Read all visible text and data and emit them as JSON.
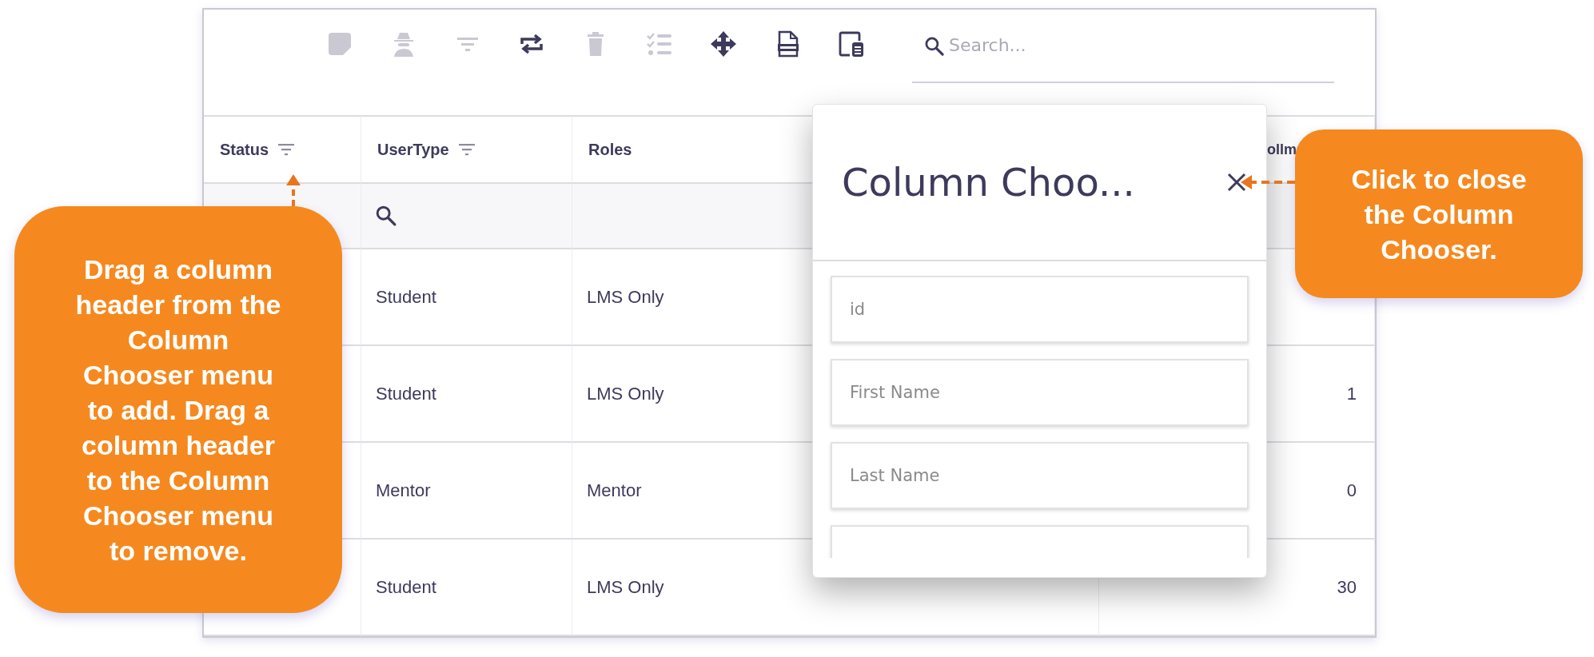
{
  "toolbar": {
    "buttons": [
      {
        "kind": "note",
        "disabled": true
      },
      {
        "kind": "spy",
        "disabled": true
      },
      {
        "kind": "filter",
        "disabled": true
      },
      {
        "kind": "repeat",
        "disabled": false
      },
      {
        "kind": "delete",
        "disabled": true
      },
      {
        "kind": "checklist",
        "disabled": true
      },
      {
        "kind": "move",
        "disabled": false
      },
      {
        "kind": "sheet",
        "disabled": false
      },
      {
        "kind": "panel",
        "disabled": false
      }
    ]
  },
  "search": {
    "placeholder": "Search..."
  },
  "table": {
    "columns": [
      {
        "label": "Status",
        "filter": true
      },
      {
        "label": "UserType",
        "filter": true
      },
      {
        "label": "Roles",
        "filter": false
      },
      {
        "label": "ollm",
        "filter": false
      }
    ],
    "filter_row": [
      {
        "kind": "blank"
      },
      {
        "kind": "search"
      },
      {
        "kind": "blank"
      },
      {
        "kind": "blank"
      }
    ],
    "rows": [
      {
        "usertype": "Student",
        "roles": "LMS Only"
      },
      {
        "usertype": "Student",
        "roles": "LMS Only",
        "column_4": "1"
      },
      {
        "usertype": "Mentor",
        "roles": "Mentor",
        "column_4": "0"
      },
      {
        "usertype": "Student",
        "roles": "LMS Only",
        "column_4": "30"
      }
    ]
  },
  "column_chooser": {
    "title": "Column Choo...",
    "fields": [
      {
        "kind": "field",
        "label": "id"
      },
      {
        "kind": "field",
        "label": "First Name"
      },
      {
        "kind": "field",
        "label": "Last Name"
      },
      {
        "kind": "partial"
      }
    ]
  },
  "callouts": [
    {
      "text": "Drag a column\nheader from the\nColumn\nChooser menu\nto add. Drag a\ncolumn header\nto the Column\nChooser menu\nto remove."
    },
    {
      "text": "Click to close\nthe Column\nChooser."
    }
  ]
}
